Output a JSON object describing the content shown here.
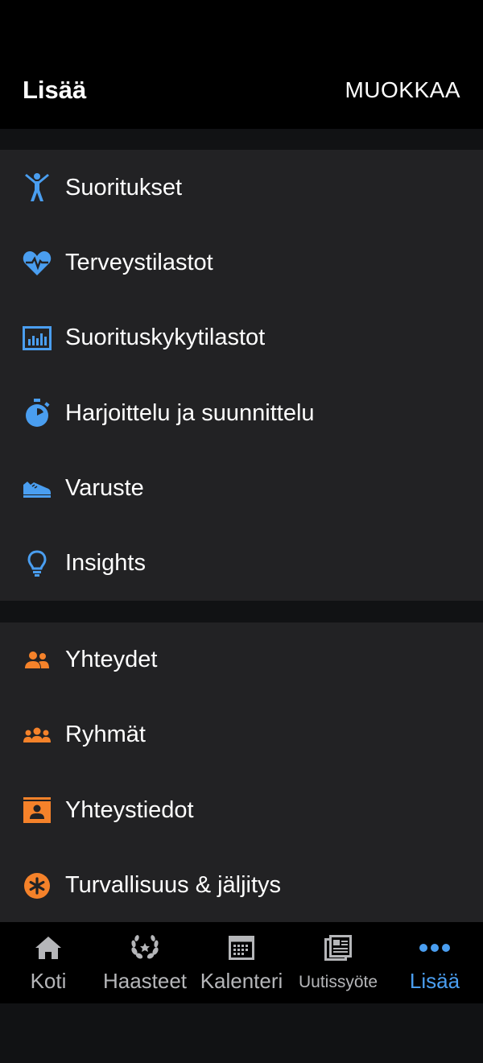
{
  "header": {
    "title": "Lisää",
    "edit_label": "MUOKKAA"
  },
  "colors": {
    "accent_blue": "#4a9ef0",
    "accent_orange": "#f5822a",
    "header_bg": "#000000",
    "section_bg": "#222224"
  },
  "section_primary": {
    "items": [
      {
        "label": "Suoritukset",
        "icon": "person-activity-icon"
      },
      {
        "label": "Terveystilastot",
        "icon": "heart-pulse-icon"
      },
      {
        "label": "Suorituskykytilastot",
        "icon": "bar-chart-icon"
      },
      {
        "label": "Harjoittelu ja suunnittelu",
        "icon": "stopwatch-icon"
      },
      {
        "label": "Varuste",
        "icon": "shoe-icon"
      },
      {
        "label": "Insights",
        "icon": "lightbulb-icon"
      }
    ]
  },
  "section_social": {
    "items": [
      {
        "label": "Yhteydet",
        "icon": "connections-icon"
      },
      {
        "label": "Ryhmät",
        "icon": "groups-icon"
      },
      {
        "label": "Yhteystiedot",
        "icon": "contact-card-icon"
      },
      {
        "label": "Turvallisuus & jäljitys",
        "icon": "safety-asterisk-icon"
      }
    ]
  },
  "tabbar": {
    "tabs": [
      {
        "label": "Koti",
        "icon": "home-icon",
        "active": false
      },
      {
        "label": "Haasteet",
        "icon": "laurel-icon",
        "active": false
      },
      {
        "label": "Kalenteri",
        "icon": "calendar-icon",
        "active": false
      },
      {
        "label": "Uutissyöte",
        "icon": "newsfeed-icon",
        "active": false
      },
      {
        "label": "Lisää",
        "icon": "more-dots-icon",
        "active": true
      }
    ]
  }
}
